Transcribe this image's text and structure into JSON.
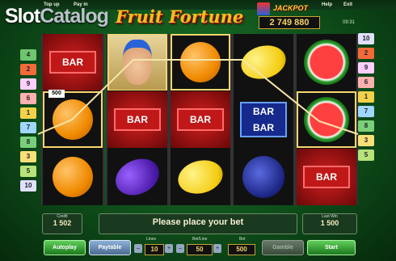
{
  "top_bar": {
    "buttons": [
      "Top up",
      "Pay in",
      "Help",
      "Exit"
    ]
  },
  "watermark": {
    "part1": "Slot",
    "part2": "Catalog"
  },
  "game_title": "Fruit Fortune",
  "jackpot": {
    "label": "JACKPOT",
    "value": "2 749 880"
  },
  "clock": "09:31",
  "lines_left": [
    "4",
    "2",
    "9",
    "6",
    "1",
    "7",
    "8",
    "3",
    "5",
    "10"
  ],
  "lines_right": [
    "10",
    "2",
    "9",
    "6",
    "1",
    "7",
    "8",
    "3",
    "5"
  ],
  "win_amount_label": "500",
  "reels": [
    [
      {
        "sym": "bar",
        "label": "BAR",
        "win": false
      },
      {
        "sym": "orange",
        "win": true
      },
      {
        "sym": "orange",
        "win": false
      }
    ],
    [
      {
        "sym": "joker",
        "win": true
      },
      {
        "sym": "bar",
        "label": "BAR",
        "win": false
      },
      {
        "sym": "plum",
        "win": false
      }
    ],
    [
      {
        "sym": "orange",
        "win": true
      },
      {
        "sym": "bar",
        "label": "BAR",
        "win": false
      },
      {
        "sym": "lemon",
        "win": false
      }
    ],
    [
      {
        "sym": "lemon",
        "win": false
      },
      {
        "sym": "bar2",
        "label": "BAR",
        "win": false
      },
      {
        "sym": "grapes",
        "win": false
      }
    ],
    [
      {
        "sym": "watermelon",
        "win": false
      },
      {
        "sym": "watermelon",
        "win": true
      },
      {
        "sym": "bar",
        "label": "BAR",
        "win": false
      }
    ]
  ],
  "panel": {
    "credit_label": "Credit",
    "credit_value": "1 502",
    "message": "Please place your bet",
    "last_win_label": "Last Win",
    "last_win_value": "1 500",
    "lines_label": "Lines",
    "lines_value": "10",
    "bet_line_label": "Bet/Line",
    "bet_line_value": "50",
    "bet_label": "Bet",
    "bet_value": "500"
  },
  "buttons": {
    "autoplay": "Autoplay",
    "paytable": "Paytable",
    "gamble": "Gamble",
    "start": "Start"
  },
  "colors": {
    "line_badges": [
      "#f2d24a",
      "#f26a3a",
      "#f7e07a",
      "#6fc56f",
      "#b8e27a",
      "#ffb0b0",
      "#9fd7ff",
      "#7ad07a",
      "#ffd0ff",
      "#e0e0ff"
    ]
  }
}
